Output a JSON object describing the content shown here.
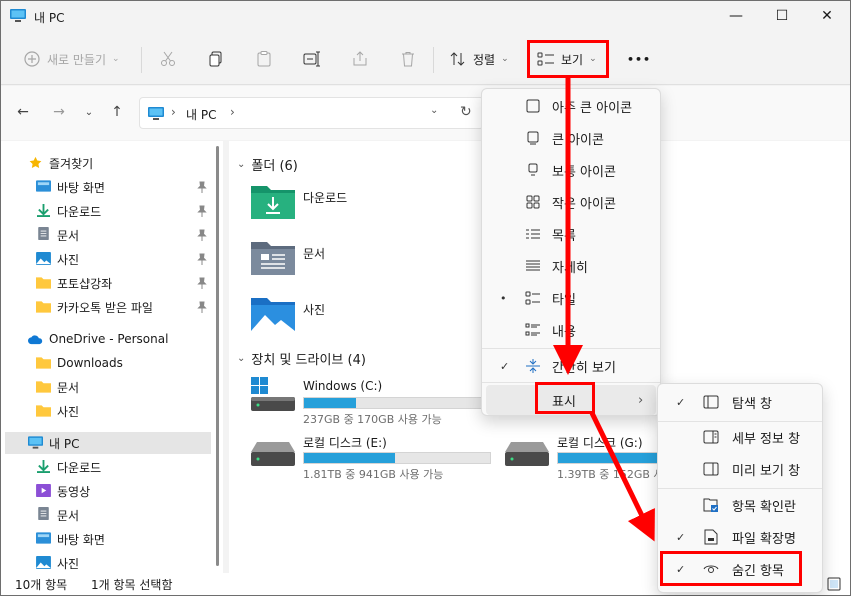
{
  "window": {
    "title": "내 PC"
  },
  "window_controls": {
    "minimize": "—",
    "maximize": "☐",
    "close": "✕"
  },
  "commandbar": {
    "new_label": "새로 만들기",
    "sort_label": "정렬",
    "view_label": "보기",
    "more_label": "•••"
  },
  "address": {
    "path": "내 PC",
    "separator": "›"
  },
  "sidebar": {
    "items": [
      {
        "label": "즐겨찾기",
        "icon": "star-icon"
      },
      {
        "label": "바탕 화면",
        "icon": "desktop-icon"
      },
      {
        "label": "다운로드",
        "icon": "download-icon"
      },
      {
        "label": "문서",
        "icon": "document-icon"
      },
      {
        "label": "사진",
        "icon": "pictures-icon"
      },
      {
        "label": "포토샵강좌",
        "icon": "folder-icon"
      },
      {
        "label": "카카오톡 받은 파일",
        "icon": "folder-icon"
      },
      {
        "label": "OneDrive - Personal",
        "icon": "cloud-icon"
      },
      {
        "label": "Downloads",
        "icon": "folder-icon"
      },
      {
        "label": "문서",
        "icon": "folder-icon"
      },
      {
        "label": "사진",
        "icon": "folder-icon"
      },
      {
        "label": "내 PC",
        "icon": "pc-icon"
      },
      {
        "label": "다운로드",
        "icon": "download-icon"
      },
      {
        "label": "동영상",
        "icon": "video-icon"
      },
      {
        "label": "문서",
        "icon": "document-icon"
      },
      {
        "label": "바탕 화면",
        "icon": "desktop-icon"
      },
      {
        "label": "사진",
        "icon": "pictures-icon"
      }
    ]
  },
  "content": {
    "folders_header": "폴더 (6)",
    "folders": [
      {
        "name": "다운로드",
        "icon": "download-folder-icon"
      },
      {
        "name": "문서",
        "icon": "documents-folder-icon"
      },
      {
        "name": "사진",
        "icon": "pictures-folder-icon"
      }
    ],
    "drives_header": "장치 및 드라이브 (4)",
    "drives": [
      {
        "name": "Windows (C:)",
        "size": "237GB 중 170GB 사용 가능",
        "used_fraction": 0.28
      },
      {
        "name": "로컬 디스크 (E:)",
        "size": "1.81TB 중 941GB 사용 가능",
        "used_fraction": 0.49
      },
      {
        "name": "로컬 디스크 (G:)",
        "size": "1.39TB 중 152GB 사용 가능",
        "used_fraction": 0.89
      }
    ]
  },
  "statusbar": {
    "item_count": "10개 항목",
    "selected": "1개 항목 선택함"
  },
  "view_menu": {
    "items": [
      {
        "label": "아주 큰 아이콘",
        "icon": "extra-large-icons-icon"
      },
      {
        "label": "큰 아이콘",
        "icon": "large-icons-icon"
      },
      {
        "label": "보통 아이콘",
        "icon": "medium-icons-icon"
      },
      {
        "label": "작은 아이콘",
        "icon": "small-icons-icon"
      },
      {
        "label": "목록",
        "icon": "list-icon"
      },
      {
        "label": "자세히",
        "icon": "details-icon"
      },
      {
        "label": "타일",
        "icon": "tiles-icon",
        "mark": "•"
      },
      {
        "label": "내용",
        "icon": "content-icon"
      },
      {
        "label": "간단히 보기",
        "icon": "compact-view-icon",
        "mark": "✓"
      },
      {
        "label": "표시",
        "icon": "",
        "submenu": "›"
      }
    ]
  },
  "show_submenu": {
    "items": [
      {
        "label": "탐색 창",
        "icon": "navigation-pane-icon",
        "mark": "✓"
      },
      {
        "label": "세부 정보 창",
        "icon": "details-pane-icon"
      },
      {
        "label": "미리 보기 창",
        "icon": "preview-pane-icon"
      },
      {
        "label": "항목 확인란",
        "icon": "item-checkbox-icon"
      },
      {
        "label": "파일 확장명",
        "icon": "file-extension-icon",
        "mark": "✓"
      },
      {
        "label": "숨긴 항목",
        "icon": "hidden-items-icon",
        "mark": "✓"
      }
    ]
  },
  "colors": {
    "accent": "#26a0da",
    "annotation": "#ff0000",
    "folder": "#ffc83d"
  }
}
